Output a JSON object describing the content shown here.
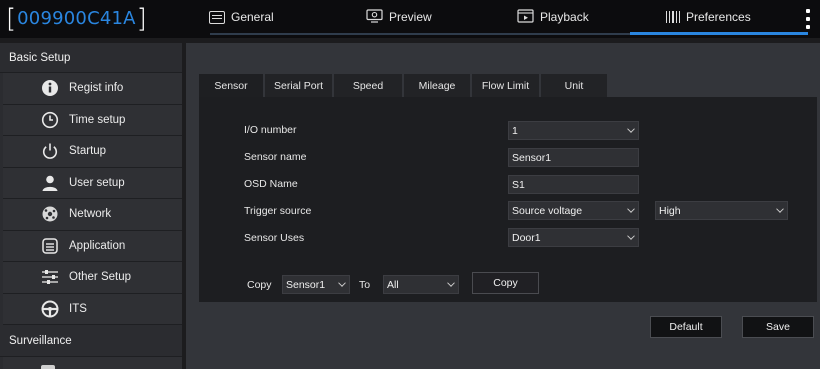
{
  "device": {
    "open_bracket": "[",
    "id": "009900C41A",
    "close_bracket": "]"
  },
  "top_tabs": [
    {
      "label": "General",
      "icon": "general-icon"
    },
    {
      "label": "Preview",
      "icon": "preview-icon"
    },
    {
      "label": "Playback",
      "icon": "playback-icon"
    },
    {
      "label": "Preferences",
      "icon": "preferences-icon",
      "active": true
    }
  ],
  "colors": {
    "accent": "#2a86e0",
    "background": "#1c1c1e",
    "sidebar": "#2b2c30",
    "panel": "#1d1e21"
  },
  "sidebar": {
    "section1": "Basic Setup",
    "items": [
      {
        "label": "Regist info",
        "icon": "info-icon"
      },
      {
        "label": "Time setup",
        "icon": "clock-icon"
      },
      {
        "label": "Startup",
        "icon": "power-icon"
      },
      {
        "label": "User setup",
        "icon": "user-icon"
      },
      {
        "label": "Network",
        "icon": "network-icon"
      },
      {
        "label": "Application",
        "icon": "application-icon"
      },
      {
        "label": "Other Setup",
        "icon": "sliders-icon"
      },
      {
        "label": "ITS",
        "icon": "steering-wheel-icon"
      }
    ],
    "section2": "Surveillance"
  },
  "sub_tabs": [
    {
      "label": "Sensor",
      "active": true
    },
    {
      "label": "Serial Port"
    },
    {
      "label": "Speed"
    },
    {
      "label": "Mileage"
    },
    {
      "label": "Flow Limit"
    },
    {
      "label": "Unit"
    }
  ],
  "form": {
    "io_number": {
      "label": "I/O number",
      "value": "1"
    },
    "sensor_name": {
      "label": "Sensor name",
      "value": "Sensor1"
    },
    "osd_name": {
      "label": "OSD Name",
      "value": "S1"
    },
    "trigger_source": {
      "label": "Trigger source",
      "value": "Source voltage",
      "level": "High"
    },
    "sensor_uses": {
      "label": "Sensor Uses",
      "value": "Door1"
    }
  },
  "copy": {
    "label": "Copy",
    "from": "Sensor1",
    "to_label": "To",
    "to": "All",
    "button": "Copy"
  },
  "actions": {
    "default": "Default",
    "save": "Save"
  }
}
